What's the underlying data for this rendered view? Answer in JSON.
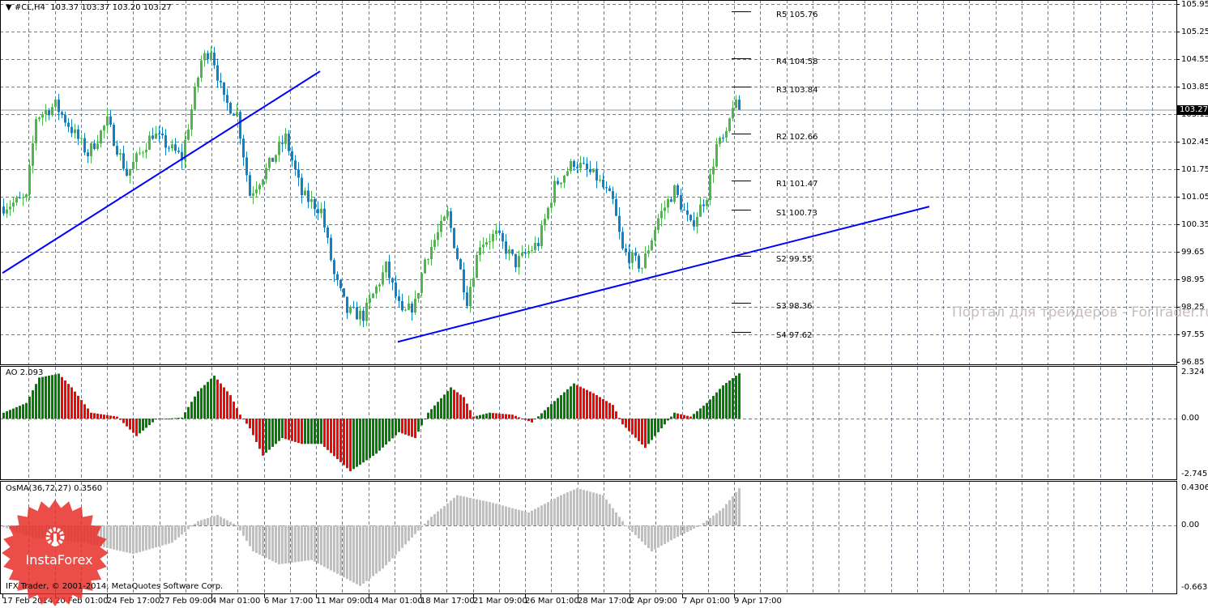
{
  "header": {
    "symbol": "#CL,H4",
    "ohlc": "103.37 103.37 103.20 103.27"
  },
  "price_axis": {
    "ticks": [
      "105.95",
      "105.25",
      "104.55",
      "103.85",
      "103.15",
      "102.45",
      "101.75",
      "101.05",
      "100.35",
      "99.65",
      "98.95",
      "98.25",
      "97.55",
      "96.85"
    ],
    "current_price": "103.27"
  },
  "pivots": [
    {
      "label": "R5 105.76",
      "value": 105.76
    },
    {
      "label": "R4 104.58",
      "value": 104.58
    },
    {
      "label": "R3 103.84",
      "value": 103.84
    },
    {
      "label": "R2 102.66",
      "value": 102.66
    },
    {
      "label": "R1 101.47",
      "value": 101.47
    },
    {
      "label": "S1 100.73",
      "value": 100.73
    },
    {
      "label": "S2 99.55",
      "value": 99.55
    },
    {
      "label": "S3 98.36",
      "value": 98.36
    },
    {
      "label": "S4 97.62",
      "value": 97.62
    }
  ],
  "time_axis": {
    "labels": [
      "17 Feb 2014",
      "20 Feb 01:00",
      "24 Feb 17:00",
      "27 Feb 09:00",
      "4 Mar 01:00",
      "6 Mar 17:00",
      "11 Mar 09:00",
      "14 Mar 01:00",
      "18 Mar 17:00",
      "21 Mar 09:00",
      "26 Mar 01:00",
      "28 Mar 17:00",
      "2 Apr 09:00",
      "7 Apr 01:00",
      "9 Apr 17:00"
    ]
  },
  "ao": {
    "label": "AO 2.093",
    "axis": [
      "2.324",
      "0.00",
      "-2.745"
    ],
    "max": 2.324,
    "min": -2.745
  },
  "osma": {
    "label": "OsMA(36,72,27) 0.3560",
    "axis": [
      "0.4306",
      "0.00",
      "-0.6637"
    ],
    "max": 0.4306,
    "min": -0.6637
  },
  "watermark": "Портал для трейдеров - ForTrader.ru",
  "logo": "InstaForex",
  "copyright": "IFX Trader, © 2001-2014, MetaQuotes Software Corp.",
  "colors": {
    "bull": "#4cb84c",
    "bear": "#0a84c8",
    "ao_up": "#008000",
    "ao_down": "#ff0000",
    "osma": "#c0c0c0",
    "trendline": "#0000ff",
    "grid": "#708090"
  },
  "chart_data": {
    "type": "candlestick",
    "symbol": "#CL",
    "timeframe": "H4",
    "ylim": [
      96.85,
      105.95
    ],
    "bar_count": 228,
    "close_keypoints": [
      [
        0,
        100.8
      ],
      [
        7,
        101.0
      ],
      [
        10,
        103.07
      ],
      [
        16,
        103.38
      ],
      [
        26,
        102.14
      ],
      [
        32,
        102.96
      ],
      [
        38,
        101.63
      ],
      [
        46,
        102.66
      ],
      [
        55,
        102.04
      ],
      [
        61,
        104.51
      ],
      [
        64,
        104.82
      ],
      [
        68,
        103.48
      ],
      [
        72,
        103.17
      ],
      [
        76,
        101.11
      ],
      [
        81,
        101.73
      ],
      [
        87,
        102.55
      ],
      [
        92,
        101.11
      ],
      [
        98,
        100.7
      ],
      [
        102,
        99.05
      ],
      [
        106,
        98.13
      ],
      [
        111,
        98.02
      ],
      [
        118,
        99.26
      ],
      [
        123,
        98.02
      ],
      [
        127,
        98.33
      ],
      [
        130,
        99.46
      ],
      [
        137,
        100.6
      ],
      [
        143,
        98.43
      ],
      [
        147,
        99.88
      ],
      [
        152,
        100.08
      ],
      [
        158,
        99.36
      ],
      [
        165,
        99.88
      ],
      [
        170,
        101.32
      ],
      [
        176,
        101.94
      ],
      [
        183,
        101.53
      ],
      [
        188,
        100.91
      ],
      [
        191,
        99.67
      ],
      [
        197,
        99.26
      ],
      [
        202,
        100.5
      ],
      [
        207,
        101.22
      ],
      [
        212,
        100.29
      ],
      [
        217,
        101.11
      ],
      [
        220,
        102.35
      ],
      [
        223,
        102.55
      ],
      [
        225,
        103.42
      ],
      [
        227,
        103.27
      ]
    ],
    "trendlines": [
      {
        "from": [
          0,
          99.11
        ],
        "to": [
          98,
          104.24
        ]
      },
      {
        "from": [
          122,
          97.36
        ],
        "to": [
          286,
          100.8
        ]
      }
    ],
    "ao_keypoints": [
      [
        0,
        0.3
      ],
      [
        7,
        0.8
      ],
      [
        11,
        2.1
      ],
      [
        17,
        2.3
      ],
      [
        21,
        1.6
      ],
      [
        27,
        0.3
      ],
      [
        35,
        0.1
      ],
      [
        41,
        -0.9
      ],
      [
        47,
        -0.05
      ],
      [
        55,
        0.05
      ],
      [
        60,
        1.4
      ],
      [
        65,
        2.2
      ],
      [
        70,
        1.2
      ],
      [
        73,
        0.2
      ],
      [
        76,
        -0.5
      ],
      [
        80,
        -1.9
      ],
      [
        86,
        -1.0
      ],
      [
        92,
        -1.3
      ],
      [
        98,
        -1.3
      ],
      [
        107,
        -2.7
      ],
      [
        115,
        -1.8
      ],
      [
        122,
        -0.7
      ],
      [
        127,
        -1.0
      ],
      [
        131,
        0.3
      ],
      [
        138,
        1.6
      ],
      [
        142,
        1.1
      ],
      [
        145,
        0.1
      ],
      [
        150,
        0.3
      ],
      [
        157,
        0.2
      ],
      [
        163,
        -0.2
      ],
      [
        170,
        0.9
      ],
      [
        176,
        1.8
      ],
      [
        182,
        1.3
      ],
      [
        188,
        0.7
      ],
      [
        191,
        -0.3
      ],
      [
        198,
        -1.5
      ],
      [
        203,
        -0.5
      ],
      [
        207,
        0.3
      ],
      [
        212,
        0.1
      ],
      [
        217,
        0.8
      ],
      [
        222,
        1.7
      ],
      [
        227,
        2.32
      ]
    ],
    "osma_keypoints": [
      [
        0,
        -0.02
      ],
      [
        10,
        -0.15
      ],
      [
        25,
        -0.2
      ],
      [
        40,
        -0.33
      ],
      [
        52,
        -0.2
      ],
      [
        60,
        0.05
      ],
      [
        66,
        0.12
      ],
      [
        72,
        0.0
      ],
      [
        77,
        -0.3
      ],
      [
        85,
        -0.45
      ],
      [
        95,
        -0.4
      ],
      [
        105,
        -0.6
      ],
      [
        110,
        -0.7
      ],
      [
        117,
        -0.5
      ],
      [
        127,
        -0.1
      ],
      [
        132,
        0.1
      ],
      [
        140,
        0.35
      ],
      [
        150,
        0.27
      ],
      [
        162,
        0.15
      ],
      [
        172,
        0.35
      ],
      [
        177,
        0.43
      ],
      [
        185,
        0.35
      ],
      [
        192,
        0.0
      ],
      [
        200,
        -0.3
      ],
      [
        207,
        -0.15
      ],
      [
        215,
        0.0
      ],
      [
        222,
        0.2
      ],
      [
        227,
        0.43
      ]
    ]
  }
}
